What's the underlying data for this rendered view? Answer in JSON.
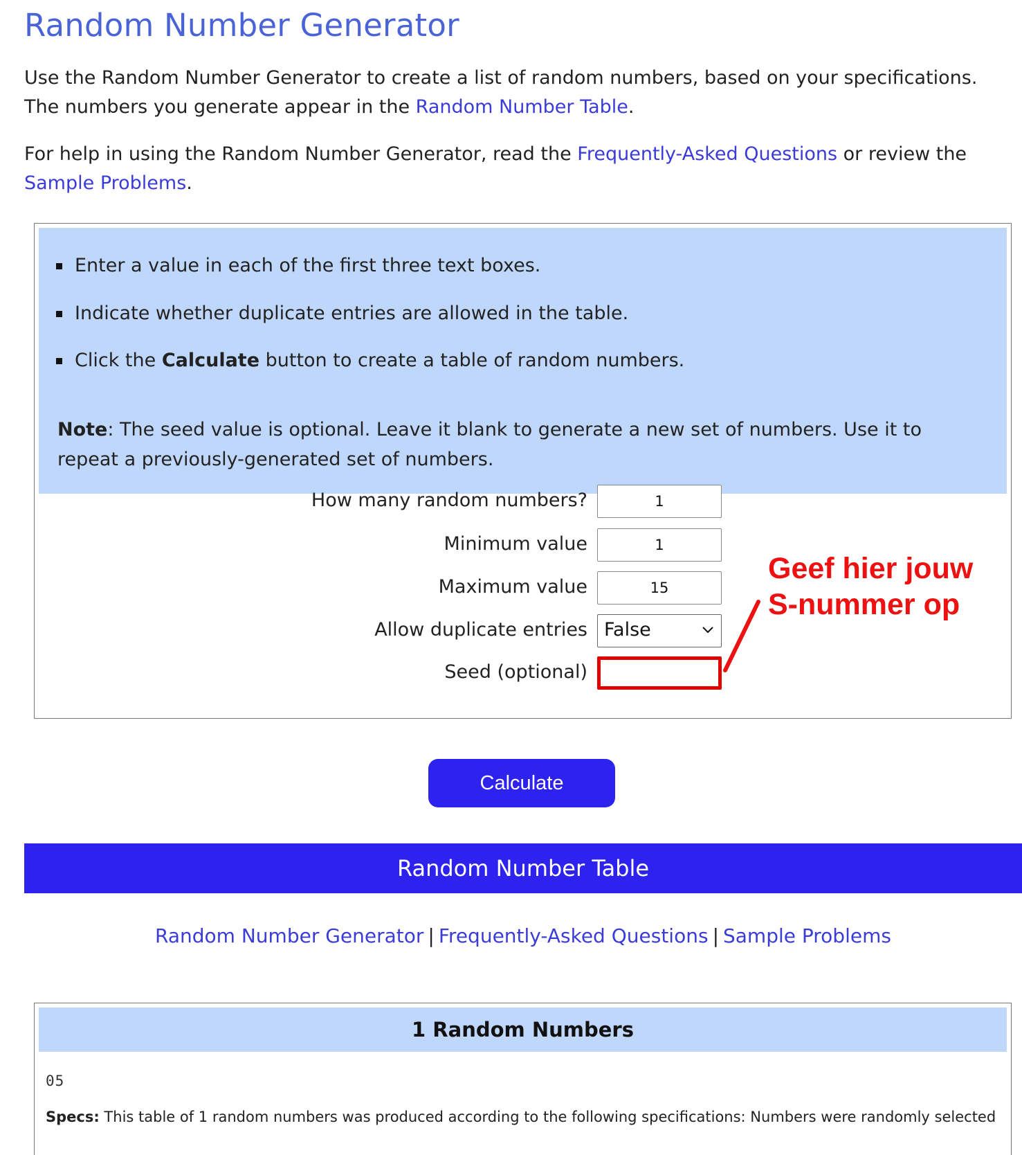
{
  "page": {
    "title": "Random Number Generator",
    "intro1": {
      "before": "Use the Random Number Generator to create a list of random numbers, based on your specifications. The numbers you generate appear in the ",
      "link": "Random Number Table",
      "after": "."
    },
    "intro2": {
      "before": "For help in using the Random Number Generator, read the ",
      "link1": "Frequently-Asked Questions",
      "middle": " or review the ",
      "link2": "Sample Problems",
      "after": "."
    }
  },
  "instructions": {
    "items": [
      {
        "text": "Enter a value in each of the first three text boxes."
      },
      {
        "text": "Indicate whether duplicate entries are allowed in the table."
      },
      {
        "before": "Click the ",
        "bold": "Calculate",
        "after": " button to create a table of random numbers."
      }
    ],
    "note_label": "Note",
    "note_text": ": The seed value is optional. Leave it blank to generate a new set of numbers. Use it to repeat a previously-generated set of numbers."
  },
  "form": {
    "count_label": "How many random numbers?",
    "count_value": "1",
    "min_label": "Minimum value",
    "min_value": "1",
    "max_label": "Maximum value",
    "max_value": "15",
    "duplicates_label": "Allow duplicate entries",
    "duplicates_value": "False",
    "seed_label": "Seed (optional)",
    "seed_value": ""
  },
  "annotation": {
    "line1": "Geef hier jouw",
    "line2": "S-nummer op",
    "color": "#ee1111"
  },
  "calculate_label": "Calculate",
  "table_bar_title": "Random Number Table",
  "footer_links": {
    "link1": "Random Number Generator",
    "link2": "Frequently-Asked Questions",
    "link3": "Sample Problems",
    "separator": "|"
  },
  "result": {
    "header": "1 Random Numbers",
    "numbers": "05",
    "specs_label": "Specs:",
    "specs_text": " This table of 1 random numbers was produced according to the following specifications: Numbers were randomly selected from within"
  },
  "colors": {
    "accent": "#2e22ef",
    "panel": "#c0d7fc",
    "link": "#3b3bd8",
    "title": "#4a64d8"
  }
}
